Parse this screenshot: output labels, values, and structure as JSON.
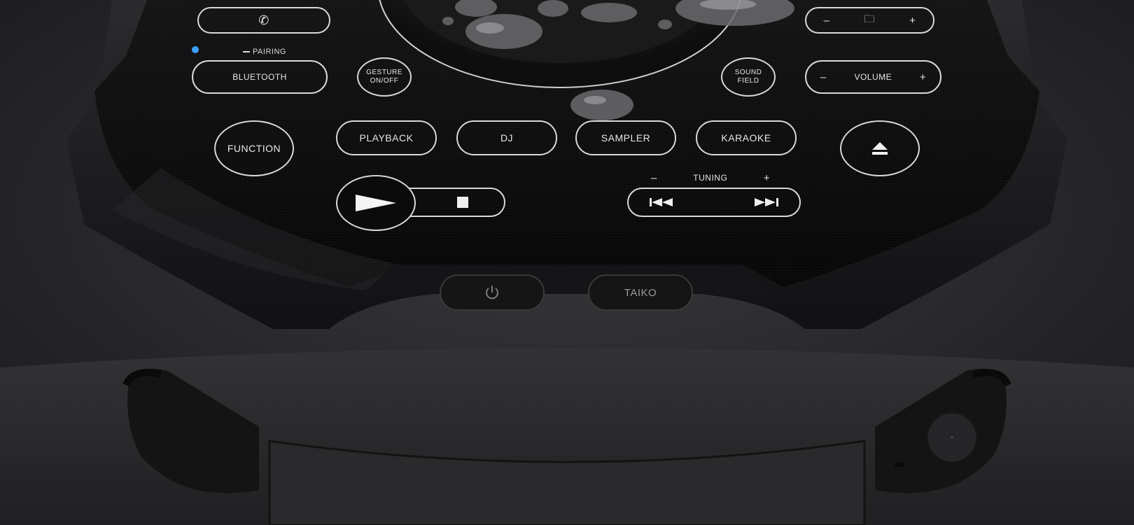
{
  "controls": {
    "call_label": "",
    "pairing_label": "PAIRING",
    "bluetooth_label": "BLUETOOTH",
    "gesture_line1": "GESTURE",
    "gesture_line2": "ON/OFF",
    "sound_field_line1": "SOUND",
    "sound_field_line2": "FIELD",
    "volume_label": "VOLUME",
    "function_label": "FUNCTION",
    "playback_label": "PLAYBACK",
    "dj_label": "DJ",
    "sampler_label": "SAMPLER",
    "karaoke_label": "KARAOKE",
    "tuning_label": "TUNING",
    "taiko_label": "TAIKO",
    "minus_glyph": "–",
    "plus_glyph": "+"
  },
  "colors": {
    "body": "#1f1f21",
    "panel": "#0c0c0d",
    "outline": "#d9d9d9",
    "pairing_led": "#3aa0ff"
  },
  "icons": [
    "phone-icon",
    "folder-icon",
    "play-icon",
    "stop-icon",
    "eject-icon",
    "previous-track-icon",
    "next-track-icon",
    "power-icon",
    "usb-port-icon"
  ]
}
